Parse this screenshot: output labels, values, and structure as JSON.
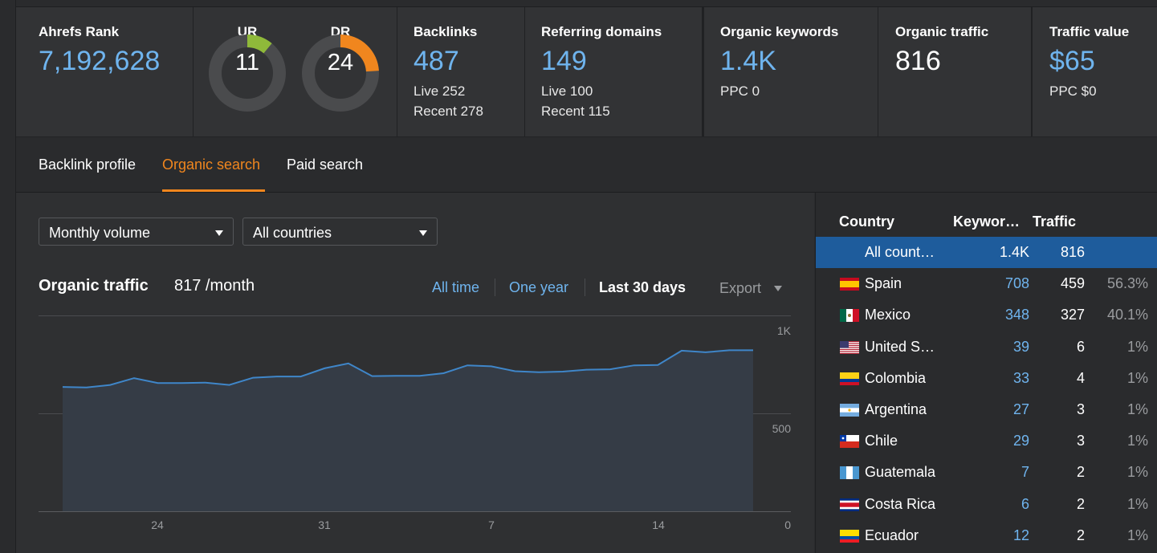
{
  "metrics": {
    "ahrefs_rank": {
      "label": "Ahrefs Rank",
      "value": "7,192,628"
    },
    "ur": {
      "label": "UR",
      "value": "11",
      "fraction": 0.11,
      "color": "#8fb93a"
    },
    "dr": {
      "label": "DR",
      "value": "24",
      "fraction": 0.24,
      "color": "#f0861e"
    },
    "backlinks": {
      "label": "Backlinks",
      "value": "487",
      "live": "Live 252",
      "recent": "Recent 278"
    },
    "ref_domains": {
      "label": "Referring domains",
      "value": "149",
      "live": "Live 100",
      "recent": "Recent 115"
    },
    "org_keywords": {
      "label": "Organic keywords",
      "value": "1.4K",
      "ppc": "PPC 0"
    },
    "org_traffic": {
      "label": "Organic traffic",
      "value": "816"
    },
    "traffic_value": {
      "label": "Traffic value",
      "value": "$65",
      "ppc": "PPC $0"
    }
  },
  "tabs": [
    {
      "label": "Backlink profile"
    },
    {
      "label": "Organic search"
    },
    {
      "label": "Paid search"
    }
  ],
  "filters": {
    "volume": "Monthly volume",
    "countries": "All countries"
  },
  "chart_header": {
    "title": "Organic traffic",
    "value": "817 /month",
    "ranges": [
      "All time",
      "One year",
      "Last 30 days"
    ],
    "export": "Export"
  },
  "chart_data": {
    "type": "area",
    "x_tick_labels": [
      "24",
      "31",
      "7",
      "14"
    ],
    "y_tick_labels": [
      "1K",
      "500",
      "0"
    ],
    "ylim": [
      0,
      1000
    ],
    "grid": true,
    "values": [
      635,
      632,
      645,
      680,
      655,
      655,
      657,
      645,
      682,
      688,
      688,
      730,
      755,
      690,
      692,
      692,
      705,
      745,
      740,
      715,
      710,
      713,
      723,
      725,
      745,
      747,
      820,
      812,
      822,
      822
    ],
    "color": "#3f86c9"
  },
  "countries": {
    "headers": {
      "country": "Country",
      "keywords": "Keywor…",
      "traffic": "Traffic"
    },
    "rows": [
      {
        "name": "All count…",
        "keywords": "1.4K",
        "traffic": "816",
        "pct": "",
        "flag": "none"
      },
      {
        "name": "Spain",
        "keywords": "708",
        "traffic": "459",
        "pct": "56.3%",
        "flag": "spain-flag"
      },
      {
        "name": "Mexico",
        "keywords": "348",
        "traffic": "327",
        "pct": "40.1%",
        "flag": "mexico-flag"
      },
      {
        "name": "United S…",
        "keywords": "39",
        "traffic": "6",
        "pct": "1%",
        "flag": "usa-flag"
      },
      {
        "name": "Colombia",
        "keywords": "33",
        "traffic": "4",
        "pct": "1%",
        "flag": "colombia-flag"
      },
      {
        "name": "Argentina",
        "keywords": "27",
        "traffic": "3",
        "pct": "1%",
        "flag": "argentina-flag"
      },
      {
        "name": "Chile",
        "keywords": "29",
        "traffic": "3",
        "pct": "1%",
        "flag": "chile-flag"
      },
      {
        "name": "Guatemala",
        "keywords": "7",
        "traffic": "2",
        "pct": "1%",
        "flag": "guatemala-flag"
      },
      {
        "name": "Costa Rica",
        "keywords": "6",
        "traffic": "2",
        "pct": "1%",
        "flag": "costa-rica-flag"
      },
      {
        "name": "Ecuador",
        "keywords": "12",
        "traffic": "2",
        "pct": "1%",
        "flag": "ecuador-flag"
      }
    ]
  }
}
